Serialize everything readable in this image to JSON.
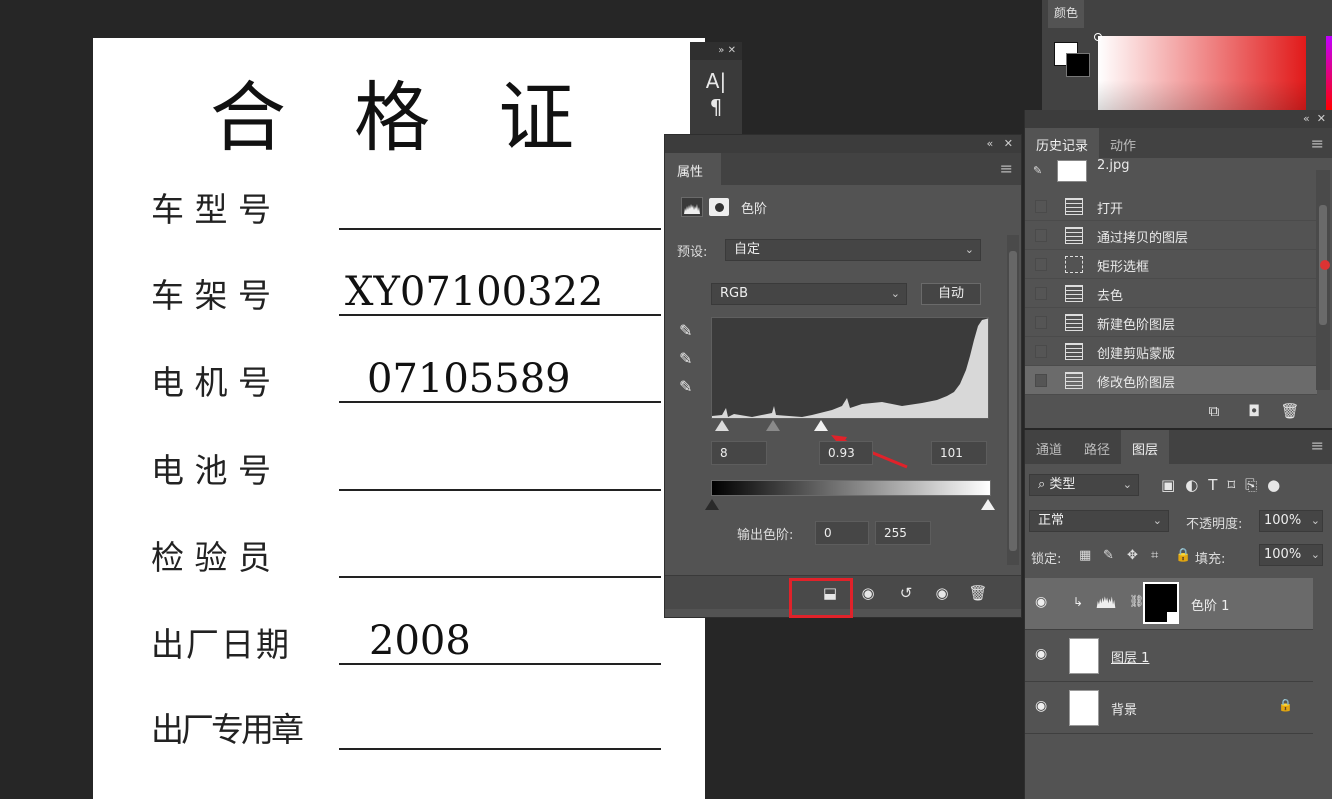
{
  "document": {
    "title": "合 格 证",
    "fields": [
      {
        "label": "车 型 号",
        "value": ""
      },
      {
        "label": "车 架 号",
        "value": "XY07100322"
      },
      {
        "label": "电 机 号",
        "value": "07105589"
      },
      {
        "label": "电 池 号",
        "value": ""
      },
      {
        "label": "检 验 员",
        "value": ""
      },
      {
        "label": "出厂日期",
        "value": "2008"
      },
      {
        "label": "出厂专用章",
        "value": ""
      }
    ]
  },
  "color_panel": {
    "tab": "颜色",
    "foreground": "#ffffff",
    "background": "#000000",
    "hue": "#e11a1a"
  },
  "character_panel": {
    "icons": [
      "character-icon",
      "paragraph-icon"
    ]
  },
  "properties": {
    "tab": "属性",
    "adjustment": "色阶",
    "preset_label": "预设:",
    "preset_value": "自定",
    "channel": "RGB",
    "auto_label": "自动",
    "input_levels": {
      "black": "8",
      "gamma": "0.93",
      "white": "101"
    },
    "output_label": "输出色阶:",
    "output_levels": {
      "black": "0",
      "white": "255"
    },
    "footer_buttons": [
      "clip-to-layer-icon",
      "view-previous-icon",
      "reset-icon",
      "visibility-icon",
      "trash-icon"
    ],
    "highlight_color": "#e0222a"
  },
  "history": {
    "tabs": [
      "历史记录",
      "动作"
    ],
    "snapshot": "2.jpg",
    "items": [
      "打开",
      "通过拷贝的图层",
      "矩形选框",
      "去色",
      "新建色阶图层",
      "创建剪贴蒙版",
      "修改色阶图层"
    ],
    "selected_index": 6
  },
  "layers": {
    "tabs": [
      "通道",
      "路径",
      "图层"
    ],
    "filter_label": "类型",
    "blend_mode": "正常",
    "opacity_label": "不透明度:",
    "opacity": "100%",
    "lock_label": "锁定:",
    "fill_label": "填充:",
    "fill": "100%",
    "items": [
      {
        "name": "色阶 1",
        "type": "adjustment",
        "selected": true
      },
      {
        "name": "图层 1",
        "type": "pixel",
        "selected": false
      },
      {
        "name": "背景",
        "type": "background",
        "selected": false
      }
    ]
  }
}
